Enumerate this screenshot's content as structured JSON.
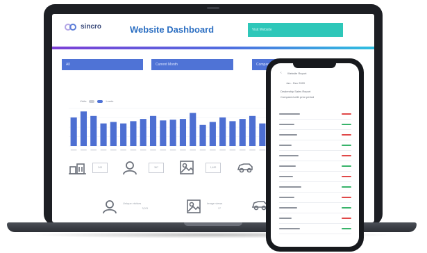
{
  "dashboard": {
    "logo_text": "sincro",
    "title": "Website Dashboard",
    "header_button_label": "Visit Website",
    "filters": [
      "All",
      "Current Month",
      "Compare"
    ]
  },
  "chart_data": {
    "type": "bar",
    "title": "",
    "legend": [
      "Visits",
      "Leads"
    ],
    "active_legend": "Leads",
    "values": [
      38,
      46,
      40,
      30,
      32,
      30,
      33,
      36,
      40,
      34,
      35,
      36,
      44,
      28,
      32,
      38,
      33,
      36,
      40,
      30
    ],
    "ylim": [
      0,
      50
    ],
    "grid": true
  },
  "stats": [
    {
      "icon": "building-icon",
      "value": "243",
      "caption": "Dealerships"
    },
    {
      "icon": "user-icon",
      "value": "367",
      "caption": "Visitors"
    },
    {
      "icon": "image-icon",
      "value": "1,482",
      "caption": "Page views"
    },
    {
      "icon": "car-icon",
      "value": "92",
      "caption": "Vehicle views"
    },
    {
      "icon": "user-icon",
      "value": "3,021",
      "caption": "Unique visitors"
    },
    {
      "icon": "image-icon",
      "value": "17",
      "caption": "Image views"
    },
    {
      "icon": "car-icon",
      "value": "",
      "caption": "Test drives"
    }
  ],
  "phone": {
    "app_title": "Website Report",
    "date_range": "Jan - Dec 2020",
    "summary_lines": [
      "Dealership Sales Report",
      "Compared with prior period"
    ],
    "value_colors": {
      "up": "#38b36a",
      "down": "#e04848"
    },
    "rows": [
      {
        "trend": "down"
      },
      {
        "trend": "up"
      },
      {
        "trend": "down"
      },
      {
        "trend": "up"
      },
      {
        "trend": "down"
      },
      {
        "trend": "up"
      },
      {
        "trend": "down"
      },
      {
        "trend": "up"
      },
      {
        "trend": "down"
      },
      {
        "trend": "up"
      },
      {
        "trend": "down"
      },
      {
        "trend": "up"
      }
    ]
  }
}
